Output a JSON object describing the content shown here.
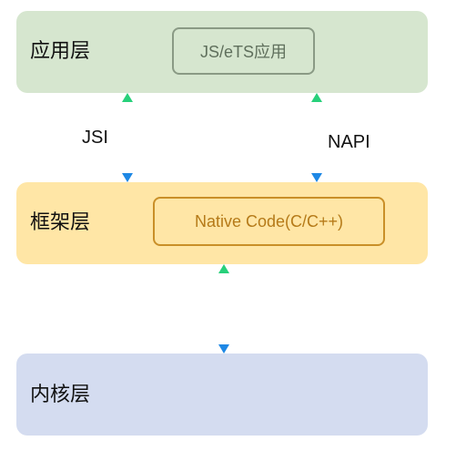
{
  "layers": {
    "application": {
      "title": "应用层",
      "component": "JS/eTS应用"
    },
    "framework": {
      "title": "框架层",
      "component": "Native Code(C/C++)"
    },
    "kernel": {
      "title": "内核层"
    }
  },
  "connections": {
    "jsi": {
      "label": "JSI"
    },
    "napi": {
      "label": "NAPI"
    }
  },
  "colors": {
    "application_bg": "#d6e6cf",
    "framework_bg": "#ffe6a6",
    "kernel_bg": "#d4dcf0",
    "arrow_top": "#27d07a",
    "arrow_bottom": "#1e88e5"
  }
}
